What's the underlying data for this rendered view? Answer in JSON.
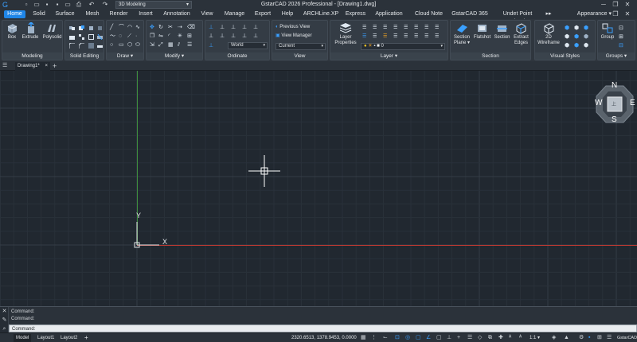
{
  "titlebar": {
    "title": "GstarCAD 2026 Professional - [Drawing1.dwg]",
    "workspace": "3D Modeling",
    "app_logo": "G"
  },
  "menu_tabs": [
    "Home",
    "Solid",
    "Surface",
    "Mesh",
    "Render",
    "Insert",
    "Annotation",
    "View",
    "Manage",
    "Export",
    "Help",
    "ARCHLine.XP",
    "Express",
    "Application",
    "Cloud Note",
    "GstarCAD 365",
    "Undet Point Cloud"
  ],
  "menu_more": "▸▸",
  "appearance_label": "Appearance ▾",
  "ribbon": {
    "modeling": {
      "title": "Modeling",
      "box": "Box",
      "extrude": "Extrude",
      "polysolid": "Polysolid"
    },
    "solid_editing": {
      "title": "Solid Editing"
    },
    "draw": {
      "title": "Draw ▾"
    },
    "modify": {
      "title": "Modify ▾"
    },
    "ordinate": {
      "title": "Ordinate",
      "world": "World"
    },
    "view": {
      "title": "View",
      "previous_view": "Previous View",
      "view_manager": "View Manager",
      "current": "Current"
    },
    "layer": {
      "title": "Layer ▾",
      "layer_properties_1": "Layer",
      "layer_properties_2": "Properties",
      "layer_value": "0"
    },
    "section": {
      "title": "Section",
      "section_plane_1": "Section",
      "section_plane_2": "Plane ▾",
      "flatshot": "Flatshot",
      "section": "Section",
      "extract_edges_1": "Extract",
      "extract_edges_2": "Edges"
    },
    "visual_styles": {
      "title": "Visual Styles",
      "wireframe_1": "2D",
      "wireframe_2": "Wireframe"
    },
    "groups": {
      "title": "Groups ▾",
      "group": "Group"
    }
  },
  "doc_tabs": {
    "drawing": "Drawing1*",
    "close": "×",
    "add": "+"
  },
  "viewcube": {
    "n": "N",
    "s": "S",
    "e": "E",
    "w": "W",
    "face": "上"
  },
  "ucs": {
    "x": "X",
    "y": "Y"
  },
  "command": {
    "history": [
      "Command:",
      "Command:"
    ],
    "prompt": "Command:"
  },
  "status": {
    "model": "Model",
    "layout1": "Layout1",
    "layout2": "Layout2",
    "add": "+",
    "coords": "2320.6513, 1378.9453, 0.0000",
    "scale": "1:1 ▾",
    "app_name": "GstarCAD"
  },
  "colors": {
    "accent": "#1f86e8",
    "x_axis": "#c23a32",
    "y_axis": "#3f8f3f",
    "bg": "#212830"
  }
}
